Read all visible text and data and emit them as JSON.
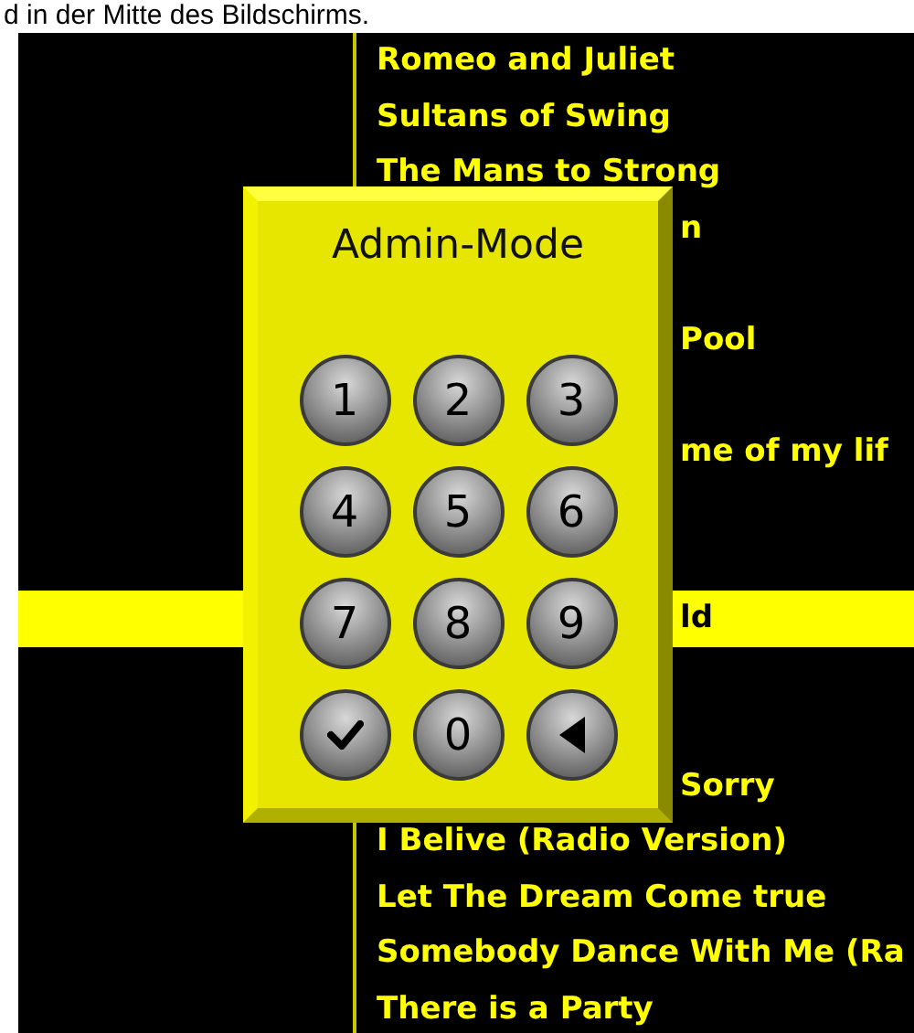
{
  "caption": "d in der Mitte des Bildschirms.",
  "songs": [
    {
      "kind": "full",
      "text": "Romeo and Juliet",
      "selected": false
    },
    {
      "kind": "full",
      "text": "Sultans of Swing",
      "selected": false
    },
    {
      "kind": "full",
      "text": "The Mans to Strong",
      "selected": false
    },
    {
      "kind": "clipped",
      "text": "n",
      "selected": false
    },
    {
      "kind": "covered"
    },
    {
      "kind": "clipped",
      "text": "Pool",
      "selected": false
    },
    {
      "kind": "covered"
    },
    {
      "kind": "clipped",
      "text": "me of my lif",
      "selected": false
    },
    {
      "kind": "covered"
    },
    {
      "kind": "covered"
    },
    {
      "kind": "clipped",
      "text": "ld",
      "selected": true
    },
    {
      "kind": "covered"
    },
    {
      "kind": "covered"
    },
    {
      "kind": "clipped",
      "text": "Sorry",
      "selected": false
    },
    {
      "kind": "full",
      "text": "I Belive (Radio Version)",
      "selected": false
    },
    {
      "kind": "full",
      "text": "Let The Dream Come true",
      "selected": false
    },
    {
      "kind": "full",
      "text": "Somebody Dance With Me (Ra",
      "selected": false
    },
    {
      "kind": "full",
      "text": "There is a Party",
      "selected": false
    }
  ],
  "keypad": {
    "title": "Admin-Mode",
    "keys": [
      {
        "kind": "digit",
        "label": "1"
      },
      {
        "kind": "digit",
        "label": "2"
      },
      {
        "kind": "digit",
        "label": "3"
      },
      {
        "kind": "digit",
        "label": "4"
      },
      {
        "kind": "digit",
        "label": "5"
      },
      {
        "kind": "digit",
        "label": "6"
      },
      {
        "kind": "digit",
        "label": "7"
      },
      {
        "kind": "digit",
        "label": "8"
      },
      {
        "kind": "digit",
        "label": "9"
      },
      {
        "kind": "confirm"
      },
      {
        "kind": "digit",
        "label": "0"
      },
      {
        "kind": "back"
      }
    ]
  }
}
